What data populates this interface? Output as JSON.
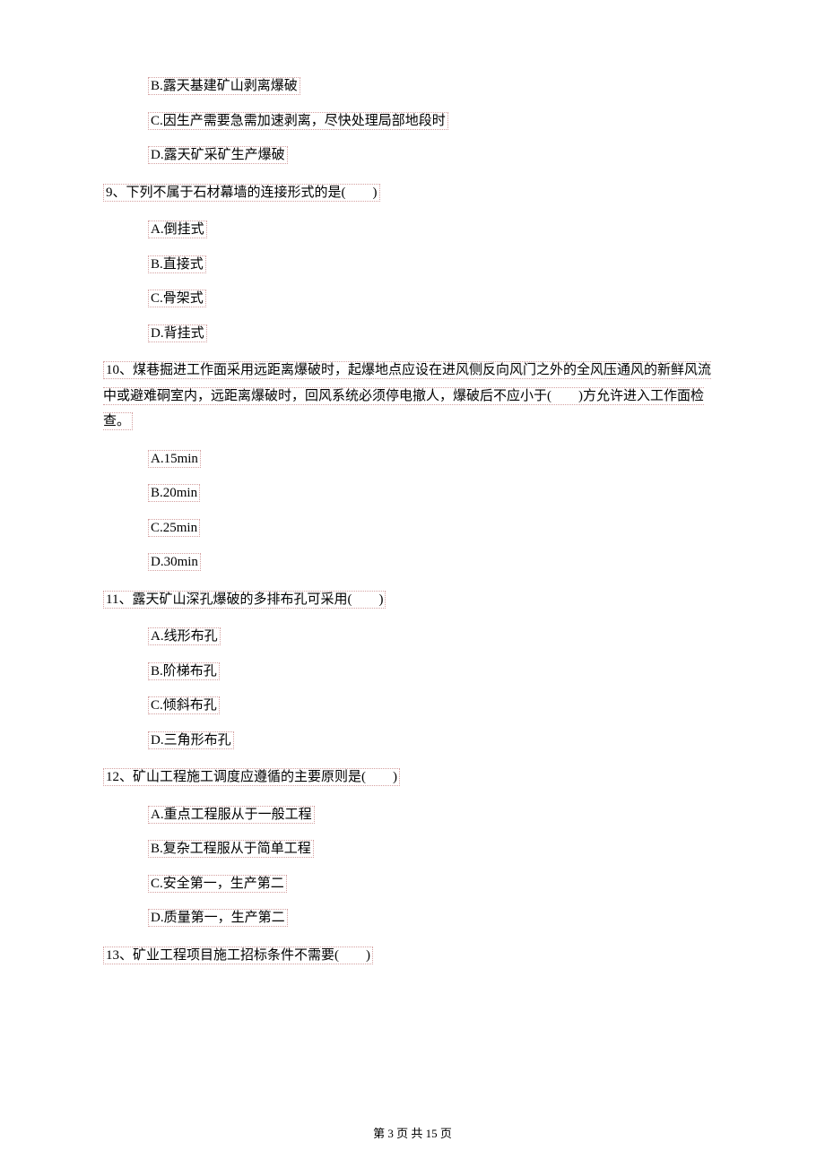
{
  "options_pre": [
    "B.露天基建矿山剥离爆破",
    "C.因生产需要急需加速剥离，尽快处理局部地段时",
    "D.露天矿采矿生产爆破"
  ],
  "questions": [
    {
      "num": "9、",
      "text": "下列不属于石材幕墙的连接形式的是(　　)",
      "options": [
        "A.倒挂式",
        "B.直接式",
        "C.骨架式",
        "D.背挂式"
      ]
    },
    {
      "num": "10、",
      "text": "煤巷掘进工作面采用远距离爆破时，起爆地点应设在进风侧反向风门之外的全风压通风的新鲜风流中或避难硐室内，远距离爆破时，回风系统必须停电撤人，爆破后不应小于(　　)方允许进入工作面检查。",
      "options": [
        "A.15min",
        "B.20min",
        "C.25min",
        "D.30min"
      ]
    },
    {
      "num": "11、",
      "text": "露天矿山深孔爆破的多排布孔可采用(　　)",
      "options": [
        "A.线形布孔",
        "B.阶梯布孔",
        "C.倾斜布孔",
        "D.三角形布孔"
      ]
    },
    {
      "num": "12、",
      "text": "矿山工程施工调度应遵循的主要原则是(　　)",
      "options": [
        "A.重点工程服从于一般工程",
        "B.复杂工程服从于简单工程",
        "C.安全第一，生产第二",
        "D.质量第一，生产第二"
      ]
    },
    {
      "num": "13、",
      "text": "矿业工程项目施工招标条件不需要(　　)",
      "options": []
    }
  ],
  "footer": "第 3 页 共 15 页"
}
